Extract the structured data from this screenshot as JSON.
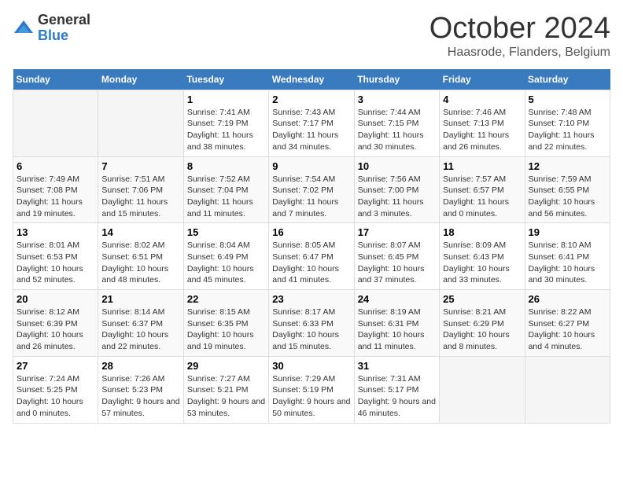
{
  "header": {
    "logo_general": "General",
    "logo_blue": "Blue",
    "month_title": "October 2024",
    "location": "Haasrode, Flanders, Belgium"
  },
  "days_of_week": [
    "Sunday",
    "Monday",
    "Tuesday",
    "Wednesday",
    "Thursday",
    "Friday",
    "Saturday"
  ],
  "weeks": [
    [
      {
        "day": "",
        "info": ""
      },
      {
        "day": "",
        "info": ""
      },
      {
        "day": "1",
        "sunrise": "7:41 AM",
        "sunset": "7:19 PM",
        "daylight": "11 hours and 38 minutes."
      },
      {
        "day": "2",
        "sunrise": "7:43 AM",
        "sunset": "7:17 PM",
        "daylight": "11 hours and 34 minutes."
      },
      {
        "day": "3",
        "sunrise": "7:44 AM",
        "sunset": "7:15 PM",
        "daylight": "11 hours and 30 minutes."
      },
      {
        "day": "4",
        "sunrise": "7:46 AM",
        "sunset": "7:13 PM",
        "daylight": "11 hours and 26 minutes."
      },
      {
        "day": "5",
        "sunrise": "7:48 AM",
        "sunset": "7:10 PM",
        "daylight": "11 hours and 22 minutes."
      }
    ],
    [
      {
        "day": "6",
        "sunrise": "7:49 AM",
        "sunset": "7:08 PM",
        "daylight": "11 hours and 19 minutes."
      },
      {
        "day": "7",
        "sunrise": "7:51 AM",
        "sunset": "7:06 PM",
        "daylight": "11 hours and 15 minutes."
      },
      {
        "day": "8",
        "sunrise": "7:52 AM",
        "sunset": "7:04 PM",
        "daylight": "11 hours and 11 minutes."
      },
      {
        "day": "9",
        "sunrise": "7:54 AM",
        "sunset": "7:02 PM",
        "daylight": "11 hours and 7 minutes."
      },
      {
        "day": "10",
        "sunrise": "7:56 AM",
        "sunset": "7:00 PM",
        "daylight": "11 hours and 3 minutes."
      },
      {
        "day": "11",
        "sunrise": "7:57 AM",
        "sunset": "6:57 PM",
        "daylight": "11 hours and 0 minutes."
      },
      {
        "day": "12",
        "sunrise": "7:59 AM",
        "sunset": "6:55 PM",
        "daylight": "10 hours and 56 minutes."
      }
    ],
    [
      {
        "day": "13",
        "sunrise": "8:01 AM",
        "sunset": "6:53 PM",
        "daylight": "10 hours and 52 minutes."
      },
      {
        "day": "14",
        "sunrise": "8:02 AM",
        "sunset": "6:51 PM",
        "daylight": "10 hours and 48 minutes."
      },
      {
        "day": "15",
        "sunrise": "8:04 AM",
        "sunset": "6:49 PM",
        "daylight": "10 hours and 45 minutes."
      },
      {
        "day": "16",
        "sunrise": "8:05 AM",
        "sunset": "6:47 PM",
        "daylight": "10 hours and 41 minutes."
      },
      {
        "day": "17",
        "sunrise": "8:07 AM",
        "sunset": "6:45 PM",
        "daylight": "10 hours and 37 minutes."
      },
      {
        "day": "18",
        "sunrise": "8:09 AM",
        "sunset": "6:43 PM",
        "daylight": "10 hours and 33 minutes."
      },
      {
        "day": "19",
        "sunrise": "8:10 AM",
        "sunset": "6:41 PM",
        "daylight": "10 hours and 30 minutes."
      }
    ],
    [
      {
        "day": "20",
        "sunrise": "8:12 AM",
        "sunset": "6:39 PM",
        "daylight": "10 hours and 26 minutes."
      },
      {
        "day": "21",
        "sunrise": "8:14 AM",
        "sunset": "6:37 PM",
        "daylight": "10 hours and 22 minutes."
      },
      {
        "day": "22",
        "sunrise": "8:15 AM",
        "sunset": "6:35 PM",
        "daylight": "10 hours and 19 minutes."
      },
      {
        "day": "23",
        "sunrise": "8:17 AM",
        "sunset": "6:33 PM",
        "daylight": "10 hours and 15 minutes."
      },
      {
        "day": "24",
        "sunrise": "8:19 AM",
        "sunset": "6:31 PM",
        "daylight": "10 hours and 11 minutes."
      },
      {
        "day": "25",
        "sunrise": "8:21 AM",
        "sunset": "6:29 PM",
        "daylight": "10 hours and 8 minutes."
      },
      {
        "day": "26",
        "sunrise": "8:22 AM",
        "sunset": "6:27 PM",
        "daylight": "10 hours and 4 minutes."
      }
    ],
    [
      {
        "day": "27",
        "sunrise": "7:24 AM",
        "sunset": "5:25 PM",
        "daylight": "10 hours and 0 minutes."
      },
      {
        "day": "28",
        "sunrise": "7:26 AM",
        "sunset": "5:23 PM",
        "daylight": "9 hours and 57 minutes."
      },
      {
        "day": "29",
        "sunrise": "7:27 AM",
        "sunset": "5:21 PM",
        "daylight": "9 hours and 53 minutes."
      },
      {
        "day": "30",
        "sunrise": "7:29 AM",
        "sunset": "5:19 PM",
        "daylight": "9 hours and 50 minutes."
      },
      {
        "day": "31",
        "sunrise": "7:31 AM",
        "sunset": "5:17 PM",
        "daylight": "9 hours and 46 minutes."
      },
      {
        "day": "",
        "info": ""
      },
      {
        "day": "",
        "info": ""
      }
    ]
  ]
}
